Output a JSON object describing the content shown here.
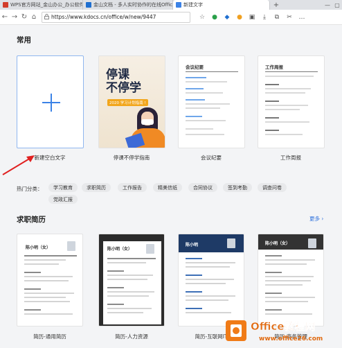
{
  "tabs": [
    {
      "label": "WPS官方网站_金山办公_办公软件",
      "color": "#d23c2a"
    },
    {
      "label": "金山文档 - 多人实时协作的在线Office",
      "color": "#1f6fd0"
    },
    {
      "label": "新建文字",
      "color": "#3b82e6"
    }
  ],
  "new_tab": "+",
  "window_controls": {
    "minimize": "—",
    "maximize": "▢"
  },
  "nav": {
    "back": "←",
    "forward": "→",
    "reload": "↻",
    "home": "⌂"
  },
  "address": {
    "lock": "🔒",
    "url": "https://www.kdocs.cn/office/w/new/9447"
  },
  "toolbar_icons": [
    "star-icon",
    "extension-a-icon",
    "extension-b-icon",
    "extension-c-icon",
    "extension-d-icon",
    "download-icon",
    "collections-icon",
    "scissors-icon",
    "menu-icon"
  ],
  "sections": {
    "common": "常用",
    "resume": "求职简历",
    "more": "更多 ›"
  },
  "common_cards": [
    {
      "caption": "新建空白文字"
    },
    {
      "caption": "停课不停学指南",
      "poster_title": "停课\n不停学",
      "poster_tag": "2020 学习计划指南 !"
    },
    {
      "caption": "会议纪要",
      "doc_title": "会议纪要"
    },
    {
      "caption": "工作周报",
      "doc_title": "工作周报"
    }
  ],
  "hot": {
    "label": "热门分类：",
    "chips": [
      "学习教育",
      "求职简历",
      "工作报告",
      "精美信纸",
      "合同协议",
      "签到考勤",
      "调查问卷",
      "党政汇报"
    ]
  },
  "resume_cards": [
    {
      "caption": "简历-通用简历",
      "name": "陈小明（女）"
    },
    {
      "caption": "简历-人力资源",
      "name": "陈小明（女）"
    },
    {
      "caption": "简历-互联网IT",
      "name": "陈小明"
    },
    {
      "caption": "简历-商务管理",
      "name": "陈小明（女）"
    }
  ],
  "watermark": {
    "brand": "Office教程网",
    "site": "www.office26.com"
  },
  "colors": {
    "accent": "#3b82e6",
    "arrow": "#e02020",
    "watermark": "#e06a10"
  }
}
